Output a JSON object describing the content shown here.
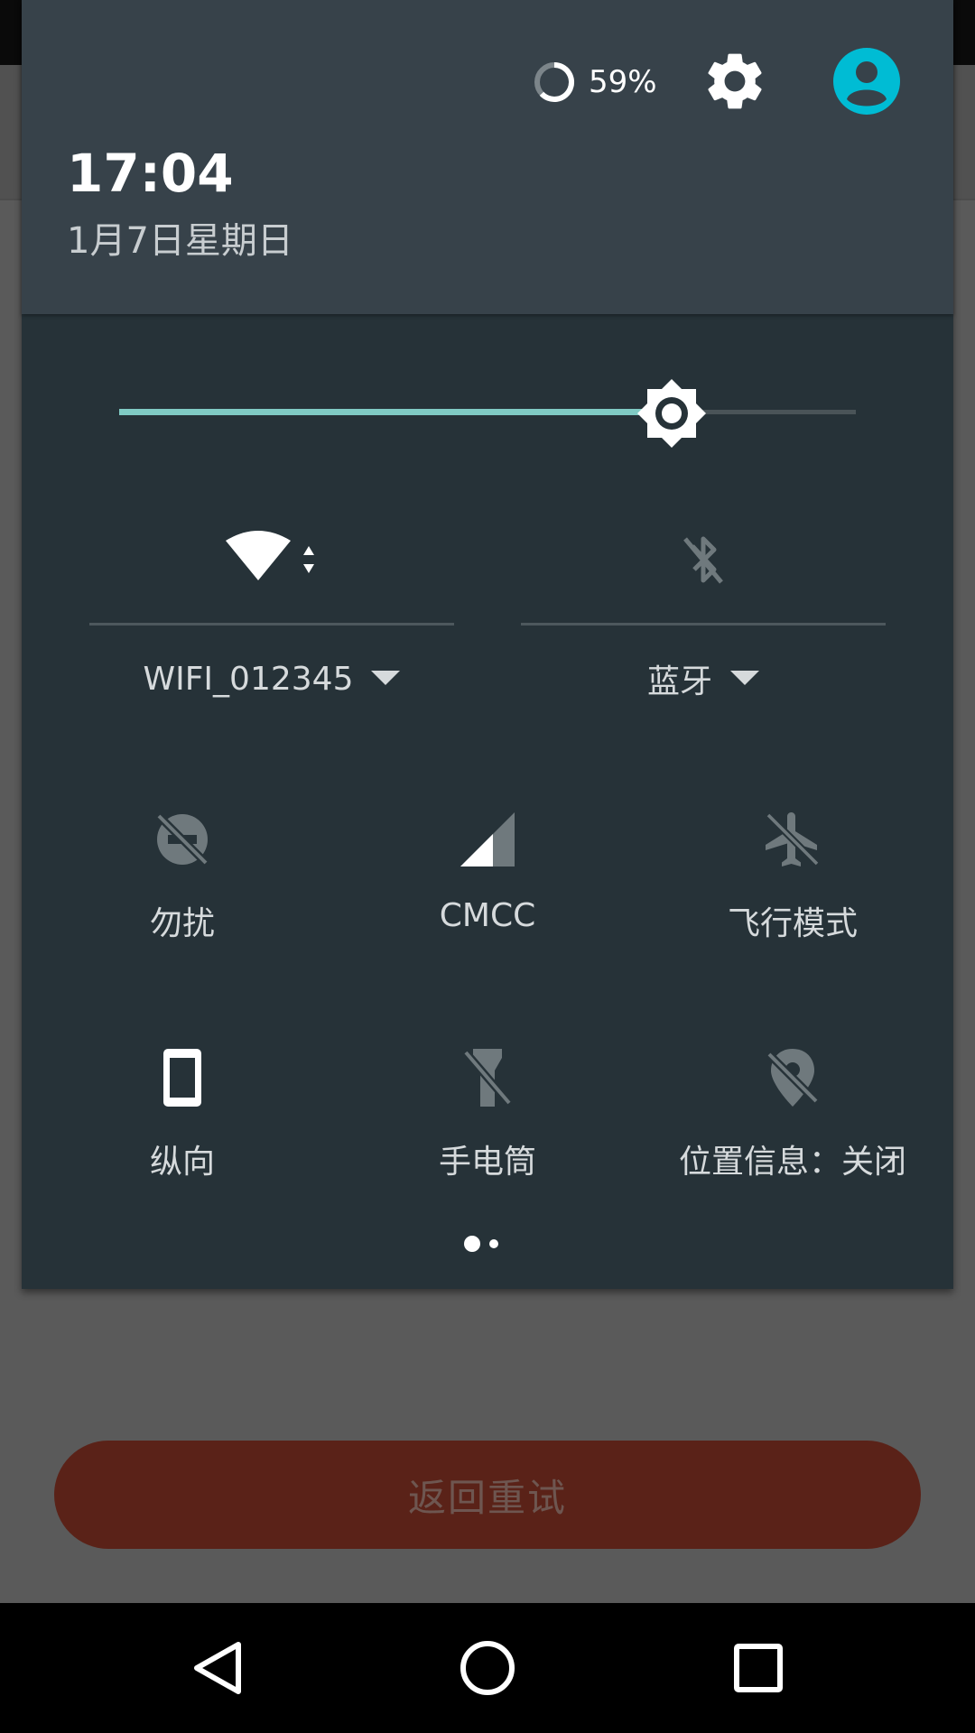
{
  "status": {
    "battery_percent": "59%",
    "time": "17:04",
    "date": "1月7日星期日"
  },
  "brightness": {
    "level": 0.75
  },
  "connectivity": {
    "wifi_name": "WIFI_012345",
    "bluetooth_label": "蓝牙"
  },
  "tiles": [
    {
      "label": "勿扰",
      "icon": "do-not-disturb-icon"
    },
    {
      "label": "CMCC",
      "icon": "cell-signal-icon"
    },
    {
      "label": "飞行模式",
      "icon": "airplane-icon"
    },
    {
      "label": "纵向",
      "icon": "portrait-orientation-icon"
    },
    {
      "label": "手电筒",
      "icon": "flashlight-off-icon"
    },
    {
      "label": "位置信息：关闭",
      "icon": "location-off-icon"
    }
  ],
  "pager": {
    "pages": 2,
    "current": 1
  },
  "app": {
    "retry_button_label": "返回重试"
  },
  "colors": {
    "panel": "#263238",
    "header": "#37424a",
    "accent": "#80cbc4",
    "avatar": "#00bcd4"
  }
}
